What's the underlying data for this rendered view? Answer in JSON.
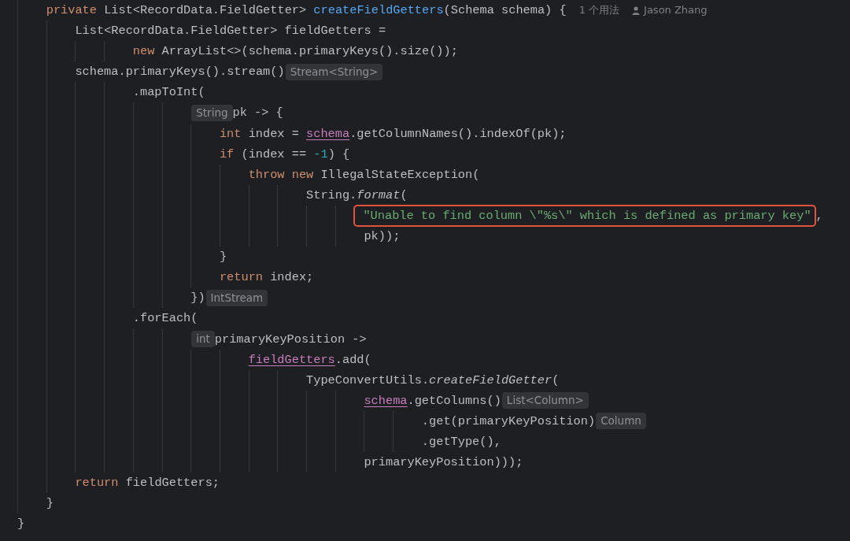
{
  "editor": {
    "lines": [
      {
        "children": [
          {
            "tokens": [
              {
                "kind": "keyword",
                "text": "private "
              },
              {
                "kind": "plain",
                "text": "List<RecordData.FieldGetter> "
              },
              {
                "kind": "method",
                "text": "createFieldGetters"
              },
              {
                "kind": "plain",
                "text": "(Schema schema) {"
              },
              {
                "kind": "usage",
                "text": "1 个用法"
              },
              {
                "kind": "author",
                "text": "Jason Zhang"
              }
            ]
          },
          {
            "children": [
              {
                "tokens": [
                  {
                    "kind": "plain",
                    "text": "List<RecordData.FieldGetter> fieldGetters ="
                  }
                ]
              },
              {
                "children": [
                  {
                    "children": [
                      {
                        "tokens": [
                          {
                            "kind": "keyword",
                            "text": "new "
                          },
                          {
                            "kind": "plain",
                            "text": "ArrayList<>(schema.primaryKeys().size());"
                          }
                        ]
                      }
                    ]
                  }
                ]
              },
              {
                "tokens": [
                  {
                    "kind": "plain",
                    "text": "schema.primaryKeys().stream()"
                  },
                  {
                    "kind": "hint",
                    "text": "Stream<String>"
                  }
                ]
              },
              {
                "children": [
                  {
                    "children": [
                      {
                        "tokens": [
                          {
                            "kind": "plain",
                            "text": ".mapToInt("
                          }
                        ]
                      },
                      {
                        "children": [
                          {
                            "children": [
                              {
                                "tokens": [
                                  {
                                    "kind": "hint",
                                    "text": "String"
                                  },
                                  {
                                    "kind": "plain",
                                    "text": "pk -> {"
                                  }
                                ]
                              },
                              {
                                "children": [
                                  {
                                    "tokens": [
                                      {
                                        "kind": "keyword",
                                        "text": "int "
                                      },
                                      {
                                        "kind": "plain",
                                        "text": "index = "
                                      },
                                      {
                                        "kind": "field",
                                        "text": "schema"
                                      },
                                      {
                                        "kind": "plain",
                                        "text": ".getColumnNames().indexOf(pk);"
                                      }
                                    ]
                                  },
                                  {
                                    "tokens": [
                                      {
                                        "kind": "keyword",
                                        "text": "if "
                                      },
                                      {
                                        "kind": "plain",
                                        "text": "(index == "
                                      },
                                      {
                                        "kind": "number",
                                        "text": "-1"
                                      },
                                      {
                                        "kind": "plain",
                                        "text": ") {"
                                      }
                                    ]
                                  },
                                  {
                                    "children": [
                                      {
                                        "tokens": [
                                          {
                                            "kind": "keyword",
                                            "text": "throw new "
                                          },
                                          {
                                            "kind": "plain",
                                            "text": "IllegalStateException("
                                          }
                                        ]
                                      },
                                      {
                                        "children": [
                                          {
                                            "children": [
                                              {
                                                "tokens": [
                                                  {
                                                    "kind": "plain",
                                                    "text": "String."
                                                  },
                                                  {
                                                    "kind": "italic",
                                                    "text": "format"
                                                  },
                                                  {
                                                    "kind": "plain",
                                                    "text": "("
                                                  }
                                                ]
                                              },
                                              {
                                                "children": [
                                                  {
                                                    "children": [
                                                      {
                                                        "tokens": [
                                                          {
                                                            "kind": "string",
                                                            "text": "\"Unable to find column \\\"%s\\\" which is defined as primary key\"",
                                                            "boxed": true
                                                          },
                                                          {
                                                            "kind": "plain",
                                                            "text": ","
                                                          }
                                                        ]
                                                      },
                                                      {
                                                        "tokens": [
                                                          {
                                                            "kind": "plain",
                                                            "text": "pk));"
                                                          }
                                                        ]
                                                      }
                                                    ]
                                                  }
                                                ]
                                              }
                                            ]
                                          }
                                        ]
                                      }
                                    ]
                                  },
                                  {
                                    "tokens": [
                                      {
                                        "kind": "plain",
                                        "text": "}"
                                      }
                                    ]
                                  },
                                  {
                                    "tokens": [
                                      {
                                        "kind": "keyword",
                                        "text": "return "
                                      },
                                      {
                                        "kind": "plain",
                                        "text": "index;"
                                      }
                                    ]
                                  }
                                ]
                              },
                              {
                                "tokens": [
                                  {
                                    "kind": "plain",
                                    "text": "})"
                                  },
                                  {
                                    "kind": "hint",
                                    "text": "IntStream"
                                  }
                                ]
                              }
                            ]
                          }
                        ]
                      },
                      {
                        "tokens": [
                          {
                            "kind": "plain",
                            "text": ".forEach("
                          }
                        ]
                      },
                      {
                        "children": [
                          {
                            "children": [
                              {
                                "tokens": [
                                  {
                                    "kind": "hint",
                                    "text": "int"
                                  },
                                  {
                                    "kind": "plain",
                                    "text": "primaryKeyPosition ->"
                                  }
                                ]
                              },
                              {
                                "children": [
                                  {
                                    "children": [
                                      {
                                        "tokens": [
                                          {
                                            "kind": "field",
                                            "text": "fieldGetters"
                                          },
                                          {
                                            "kind": "plain",
                                            "text": ".add("
                                          }
                                        ]
                                      },
                                      {
                                        "children": [
                                          {
                                            "children": [
                                              {
                                                "tokens": [
                                                  {
                                                    "kind": "plain",
                                                    "text": "TypeConvertUtils."
                                                  },
                                                  {
                                                    "kind": "italic",
                                                    "text": "createFieldGetter"
                                                  },
                                                  {
                                                    "kind": "plain",
                                                    "text": "("
                                                  }
                                                ]
                                              },
                                              {
                                                "children": [
                                                  {
                                                    "children": [
                                                      {
                                                        "tokens": [
                                                          {
                                                            "kind": "field",
                                                            "text": "schema"
                                                          },
                                                          {
                                                            "kind": "plain",
                                                            "text": ".getColumns()"
                                                          },
                                                          {
                                                            "kind": "hint",
                                                            "text": "List<Column>"
                                                          }
                                                        ]
                                                      },
                                                      {
                                                        "children": [
                                                          {
                                                            "children": [
                                                              {
                                                                "tokens": [
                                                                  {
                                                                    "kind": "plain",
                                                                    "text": ".get(primaryKeyPosition)"
                                                                  },
                                                                  {
                                                                    "kind": "hint",
                                                                    "text": "Column"
                                                                  }
                                                                ]
                                                              },
                                                              {
                                                                "tokens": [
                                                                  {
                                                                    "kind": "plain",
                                                                    "text": ".getType(),"
                                                                  }
                                                                ]
                                                              }
                                                            ]
                                                          }
                                                        ]
                                                      },
                                                      {
                                                        "tokens": [
                                                          {
                                                            "kind": "plain",
                                                            "text": "primaryKeyPosition)));"
                                                          }
                                                        ]
                                                      }
                                                    ]
                                                  }
                                                ]
                                              }
                                            ]
                                          }
                                        ]
                                      }
                                    ]
                                  }
                                ]
                              }
                            ]
                          }
                        ]
                      }
                    ]
                  }
                ]
              },
              {
                "tokens": [
                  {
                    "kind": "keyword",
                    "text": "return "
                  },
                  {
                    "kind": "plain",
                    "text": "fieldGetters;"
                  }
                ]
              }
            ]
          },
          {
            "tokens": [
              {
                "kind": "plain",
                "text": "}"
              }
            ]
          }
        ]
      },
      {
        "tokens": [
          {
            "kind": "plain",
            "text": "}"
          }
        ]
      }
    ]
  }
}
